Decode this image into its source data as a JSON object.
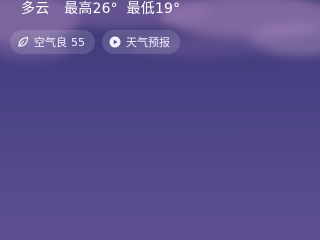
{
  "weather": {
    "condition": "多云",
    "high": "最高26°",
    "low": "最低19°"
  },
  "chips": {
    "air_quality": {
      "label": "空气良",
      "value": "55",
      "icon": "leaf-icon"
    },
    "forecast": {
      "label": "天气预报",
      "icon": "play-icon"
    }
  },
  "colors": {
    "background_top": "#3c3771",
    "background_bottom": "#5e4f93",
    "chip_bg": "rgba(255,255,255,0.14)"
  }
}
